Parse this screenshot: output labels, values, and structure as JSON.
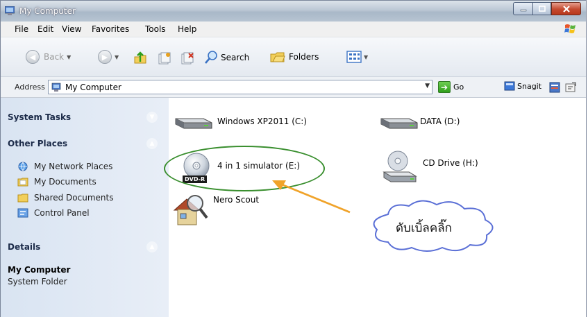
{
  "window": {
    "title": "My Computer"
  },
  "menu": [
    "File",
    "Edit",
    "View",
    "Favorites",
    "Tools",
    "Help"
  ],
  "toolbar": {
    "back": "Back",
    "search": "Search",
    "folders": "Folders"
  },
  "address": {
    "label": "Address",
    "value": "My Computer",
    "go": "Go",
    "snagit": "Snagit"
  },
  "left_pane": {
    "system_tasks": "System Tasks",
    "other_places": "Other Places",
    "places": [
      "My Network Places",
      "My Documents",
      "Shared Documents",
      "Control Panel"
    ],
    "details": "Details",
    "details_name": "My Computer",
    "details_type": "System Folder"
  },
  "drives": {
    "c": "Windows  XP2011 (C:)",
    "d": "DATA (D:)",
    "e": "4 in 1 simulator (E:)",
    "e_badge": "DVD-R",
    "h": "CD Drive (H:)",
    "nero": "Nero Scout"
  },
  "annotation": {
    "callout_text": "ดับเบิ้ลคลิ๊ก",
    "highlight_color": "#3a8f2f",
    "arrow_color": "#f0a32a",
    "cloud_color": "#5a6fd6"
  }
}
